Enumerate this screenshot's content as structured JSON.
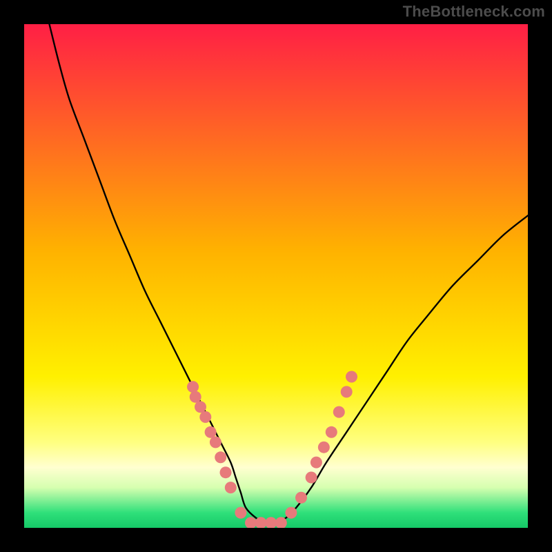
{
  "attribution": "TheBottleneck.com",
  "chart_data": {
    "type": "line",
    "title": "",
    "xlabel": "",
    "ylabel": "",
    "xlim": [
      0,
      100
    ],
    "ylim": [
      0,
      100
    ],
    "gradient_stops": [
      {
        "offset": 0.0,
        "color": "#ff1f45"
      },
      {
        "offset": 0.45,
        "color": "#ffb200"
      },
      {
        "offset": 0.7,
        "color": "#fff000"
      },
      {
        "offset": 0.83,
        "color": "#ffff80"
      },
      {
        "offset": 0.88,
        "color": "#ffffd0"
      },
      {
        "offset": 0.92,
        "color": "#d6ffb0"
      },
      {
        "offset": 0.97,
        "color": "#2fe07a"
      },
      {
        "offset": 1.0,
        "color": "#15c867"
      }
    ],
    "series": [
      {
        "name": "bottleneck-curve",
        "x": [
          5,
          7,
          9,
          12,
          15,
          18,
          21,
          24,
          27,
          30,
          33,
          35,
          37,
          39,
          41,
          42,
          43,
          44,
          46,
          48,
          50,
          52,
          54,
          57,
          60,
          64,
          68,
          72,
          76,
          80,
          85,
          90,
          95,
          100
        ],
        "y": [
          100,
          92,
          85,
          77,
          69,
          61,
          54,
          47,
          41,
          35,
          29,
          25,
          21,
          17,
          13,
          10,
          7,
          4,
          2,
          1,
          1,
          2,
          4,
          8,
          13,
          19,
          25,
          31,
          37,
          42,
          48,
          53,
          58,
          62
        ]
      }
    ],
    "markers": {
      "name": "highlight-dots",
      "color": "#e77a7b",
      "points": [
        {
          "x": 33.5,
          "y": 28
        },
        {
          "x": 34.0,
          "y": 26
        },
        {
          "x": 35.0,
          "y": 24
        },
        {
          "x": 36.0,
          "y": 22
        },
        {
          "x": 37.0,
          "y": 19
        },
        {
          "x": 38.0,
          "y": 17
        },
        {
          "x": 39.0,
          "y": 14
        },
        {
          "x": 40.0,
          "y": 11
        },
        {
          "x": 41.0,
          "y": 8
        },
        {
          "x": 43.0,
          "y": 3
        },
        {
          "x": 45.0,
          "y": 1
        },
        {
          "x": 47.0,
          "y": 1
        },
        {
          "x": 49.0,
          "y": 1
        },
        {
          "x": 51.0,
          "y": 1
        },
        {
          "x": 53.0,
          "y": 3
        },
        {
          "x": 55.0,
          "y": 6
        },
        {
          "x": 57.0,
          "y": 10
        },
        {
          "x": 58.0,
          "y": 13
        },
        {
          "x": 59.5,
          "y": 16
        },
        {
          "x": 61.0,
          "y": 19
        },
        {
          "x": 62.5,
          "y": 23
        },
        {
          "x": 64.0,
          "y": 27
        },
        {
          "x": 65.0,
          "y": 30
        }
      ]
    }
  }
}
